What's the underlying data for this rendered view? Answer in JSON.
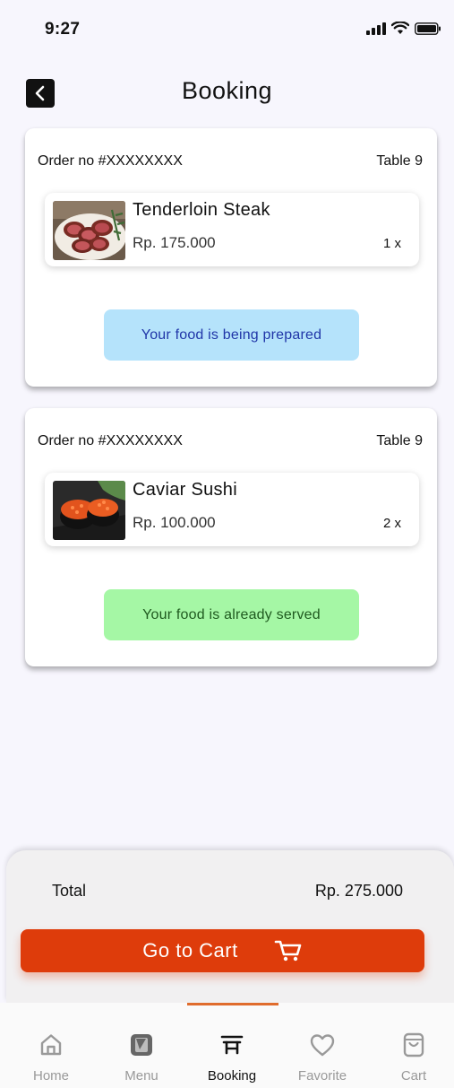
{
  "status_bar": {
    "time": "9:27"
  },
  "header": {
    "title": "Booking"
  },
  "orders": [
    {
      "order_no": "Order no #XXXXXXXX",
      "table": "Table 9",
      "item_name": "Tenderloin Steak",
      "price": "Rp. 175.000",
      "qty": "1 x",
      "status": "Your food is being prepared",
      "status_bg": "#b5e3fb",
      "status_color": "#2036a8"
    },
    {
      "order_no": "Order no #XXXXXXXX",
      "table": "Table 9",
      "item_name": "Caviar Sushi",
      "price": "Rp. 100.000",
      "qty": "2 x",
      "status": "Your food is already served",
      "status_bg": "#a5f7a5",
      "status_color": "#1f5a1f"
    }
  ],
  "summary": {
    "total_label": "Total",
    "total_value": "Rp. 275.000"
  },
  "cart_button": {
    "label": "Go to Cart",
    "icon": "cart-icon",
    "color": "#de3c0b"
  },
  "tabs": [
    {
      "label": "Home",
      "icon": "home-icon"
    },
    {
      "label": "Menu",
      "icon": "menu-icon"
    },
    {
      "label": "Booking",
      "icon": "booking-icon",
      "active": true
    },
    {
      "label": "Favorite",
      "icon": "heart-icon"
    },
    {
      "label": "Cart",
      "icon": "bag-icon"
    }
  ],
  "accent": "#e06c2d"
}
